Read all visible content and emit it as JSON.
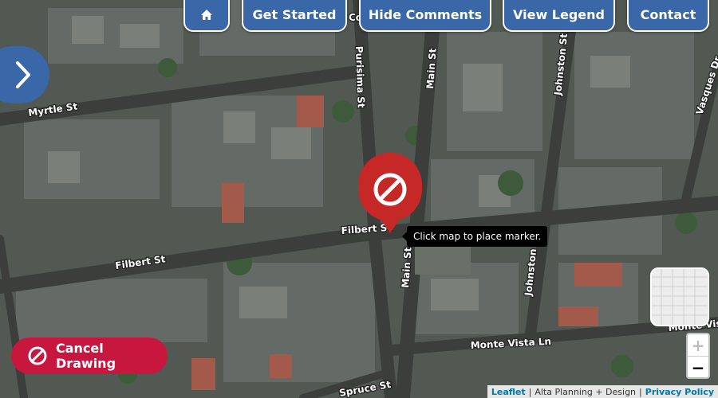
{
  "nav": {
    "home_icon": "home-icon",
    "get_started": "Get Started",
    "hide_comments": "Hide Comments",
    "view_legend": "View Legend",
    "contact": "Contact"
  },
  "streets": {
    "myrtle": "Myrtle St",
    "filbert_1": "Filbert St",
    "filbert_2": "Filbert St",
    "purisima": "Purisima St",
    "main_1": "Main St",
    "main_2": "Main St",
    "johnston_1": "Johnston St",
    "johnston_2": "Johnston St",
    "vasques": "Vasques Dr",
    "monte_vista_1": "Monte Vista Ln",
    "monte_vista_2": "Monte Vista",
    "spruce": "Spruce St",
    "top_cut": "Co"
  },
  "tooltip": "Click map to place marker.",
  "cancel_button": "Cancel Drawing",
  "marker": {
    "icon": "no-entry-icon",
    "color": "#c62828"
  },
  "attribution": {
    "leaflet": "Leaflet",
    "sep1": "|",
    "credit": "Alta Planning + Design",
    "sep2": "|",
    "privacy": "Privacy Policy"
  },
  "zoom": {
    "in": "+",
    "out": "−"
  },
  "colors": {
    "nav": "#3a67a8",
    "cancel": "#c8173e"
  }
}
